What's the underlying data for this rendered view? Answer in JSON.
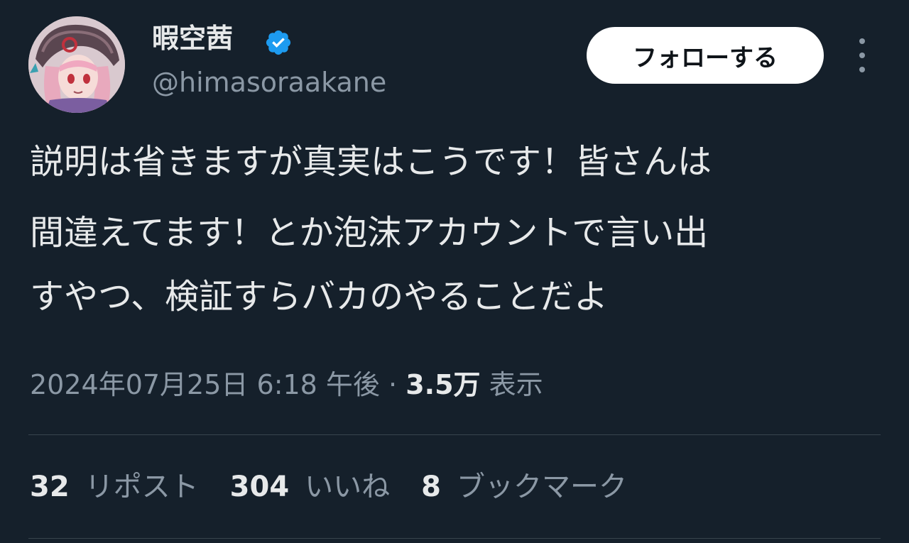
{
  "user": {
    "display_name": "暇空茜",
    "handle": "@himasoraakane",
    "verified": true,
    "avatar_icon": "avatar-image"
  },
  "follow_button_label": "フォローする",
  "more_icon": "more-vertical-icon",
  "tweet": {
    "lines": [
      "説明は省きますが真実はこうです！皆さんは",
      "間違えてます！とか泡沫アカウントで言い出",
      "すやつ、検証すらバカのやることだよ"
    ],
    "date": "2024年07月25日",
    "time": "6:18 午後",
    "separator": "·",
    "views_count": "3.5万",
    "views_label": "表示"
  },
  "stats": {
    "reposts_count": "32",
    "reposts_label": "リポスト",
    "likes_count": "304",
    "likes_label": "いいね",
    "bookmarks_count": "8",
    "bookmarks_label": "ブックマーク"
  },
  "colors": {
    "background": "#15202b",
    "text_primary": "#e7e9ea",
    "text_secondary": "#8b98a5",
    "verified_blue": "#1d9bf0",
    "divider": "#38444d"
  }
}
